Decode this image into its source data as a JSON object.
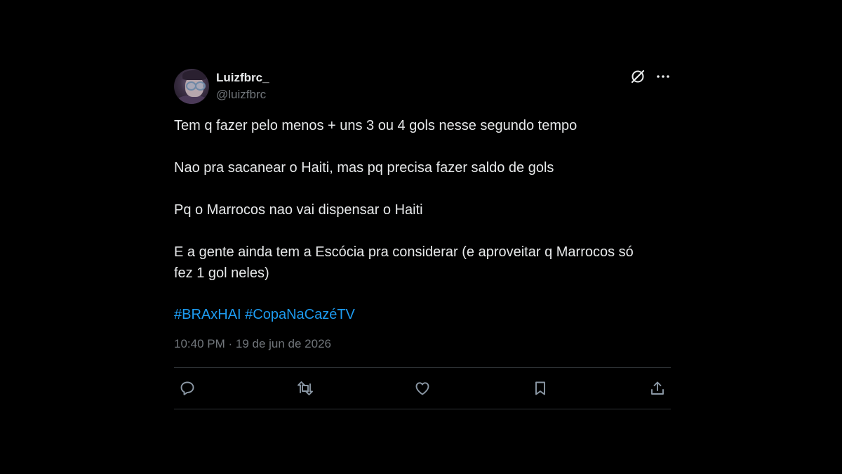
{
  "author": {
    "display_name": "Luizfbrc_",
    "handle": "@luizfbrc",
    "avatar_icon": "avatar-photo"
  },
  "header_icons": [
    "grok-icon",
    "more-options-icon"
  ],
  "tweet": {
    "paragraphs": [
      "Tem q fazer pelo menos + uns 3 ou 4 gols nesse segundo tempo",
      "Nao pra sacanear o Haiti, mas pq precisa fazer saldo de gols",
      "Pq o Marrocos nao vai dispensar o Haiti",
      "E a gente ainda tem a Escócia pra considerar (e aproveitar q Marrocos só\nfez 1 gol neles)"
    ],
    "hashtags": "#BRAxHAI #CopaNaCazéTV",
    "timestamp": "10:40 PM · 19 de jun de 2026"
  },
  "actions": [
    "reply-icon",
    "retweet-icon",
    "like-icon",
    "bookmark-icon",
    "share-icon"
  ],
  "colors": {
    "background": "#000000",
    "text": "#e7e9ea",
    "secondary": "#71767b",
    "link": "#1d9bf0",
    "divider": "#2f3336"
  }
}
